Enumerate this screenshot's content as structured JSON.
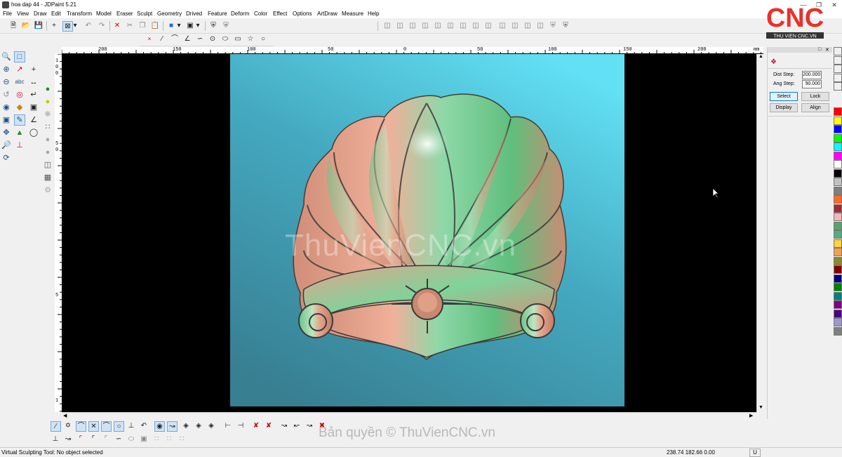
{
  "window": {
    "title": "hoa dap 44 - JDPaint 5.21"
  },
  "menu": [
    "File",
    "View",
    "Draw",
    "Edit",
    "Transform",
    "Model",
    "Eraser",
    "Sculpt",
    "Geometry",
    "Drived",
    "Feature",
    "Deform",
    "Color",
    "Effect",
    "Options",
    "ArtDraw",
    "Measure",
    "Help"
  ],
  "hruler": {
    "unit": "mm",
    "labels": [
      "200",
      "150",
      "100",
      "50",
      "0",
      "50",
      "100",
      "150",
      "200"
    ]
  },
  "vruler": {
    "labels": [
      "1",
      "0",
      "0",
      "5",
      "0",
      "5",
      "1"
    ]
  },
  "canvas": {
    "watermark": "ThuVienCNC.vn",
    "background_color": "#000000",
    "relief_bg_top": "#5fd0e8",
    "relief_bg_bottom": "#3a8a9c"
  },
  "panel": {
    "dist_step_label": "Dist Step:",
    "dist_step_value": "200.000",
    "ang_step_label": "Ang Step:",
    "ang_step_value": "90.000",
    "select": "Select",
    "lock": "Lock",
    "display": "Display",
    "align": "Align"
  },
  "palette": [
    "#ff0000",
    "#ffff00",
    "#0000ff",
    "#00ff00",
    "#00ffff",
    "#ff00ff",
    "#ffffff",
    "#000000",
    "#c0c0c0",
    "#808080",
    "#ff6a2a",
    "#a52a2a",
    "#f4b6b6",
    "#5aa36e",
    "#4caf8a",
    "#ffd23f",
    "#f0a050",
    "#8b8b2a",
    "#800000",
    "#000080",
    "#008000",
    "#008080",
    "#800080",
    "#4b0082",
    "#9a9ac8",
    "#808080"
  ],
  "logo": {
    "text": "CNC",
    "caption": "THU VIEN CNC.VN"
  },
  "copyright": "Bản quyền © ThuVienCNC.vn",
  "status": {
    "message": "Virtual Sculpting Tool: No object selected",
    "coords": "238.74 182.66 0.00",
    "unit": "U"
  }
}
